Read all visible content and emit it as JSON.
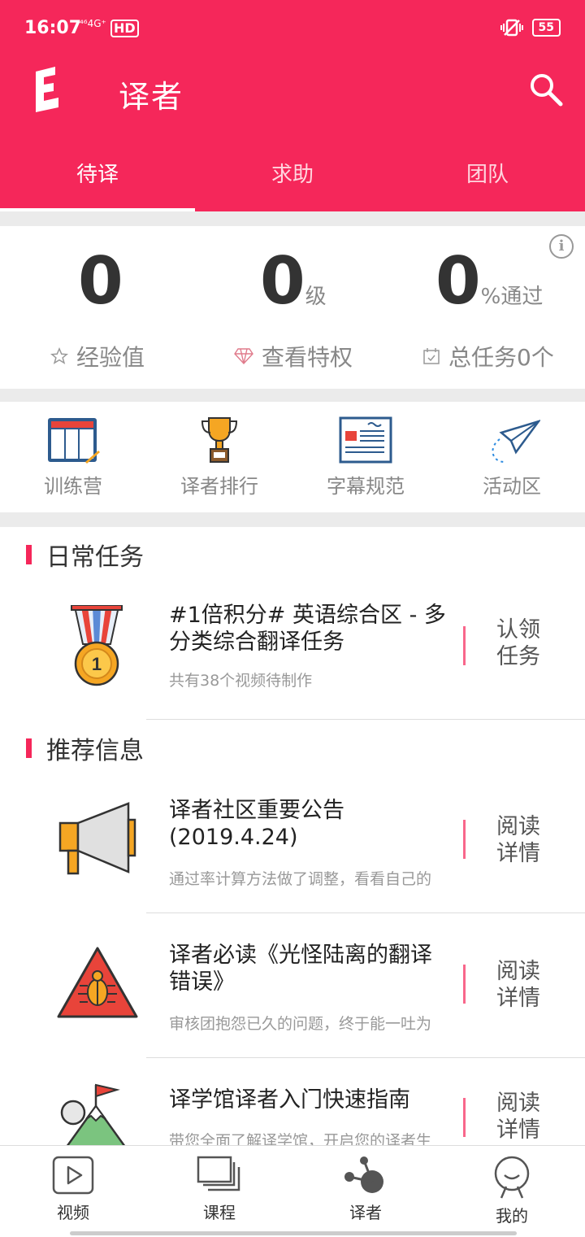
{
  "status_bar": {
    "time": "16:07",
    "signal": "⁴⁶4G⁺",
    "hd": "HD",
    "battery": "55"
  },
  "header": {
    "title": "译者"
  },
  "tabs": [
    {
      "label": "待译",
      "active": true
    },
    {
      "label": "求助",
      "active": false
    },
    {
      "label": "团队",
      "active": false
    }
  ],
  "stats": {
    "experience": {
      "value": "0",
      "label": "经验值"
    },
    "level": {
      "value": "0",
      "unit": "级",
      "label": "查看特权"
    },
    "pass_rate": {
      "value": "0",
      "unit": "%通过",
      "label": "总任务0个"
    }
  },
  "quick_links": [
    {
      "label": "训练营",
      "icon": "training-camp-icon"
    },
    {
      "label": "译者排行",
      "icon": "trophy-icon"
    },
    {
      "label": "字幕规范",
      "icon": "document-icon"
    },
    {
      "label": "活动区",
      "icon": "paper-plane-icon"
    }
  ],
  "daily_tasks": {
    "title": "日常任务",
    "items": [
      {
        "title": "#1倍积分# 英语综合区 - 多分类综合翻译任务",
        "desc": "共有38个视频待制作",
        "action": "认领任务",
        "icon": "medal-icon"
      }
    ]
  },
  "recommendations": {
    "title": "推荐信息",
    "items": [
      {
        "title": "译者社区重要公告(2019.4.24)",
        "desc": "通过率计算方法做了调整，看看自己的",
        "action": "阅读详情",
        "icon": "megaphone-icon"
      },
      {
        "title": "译者必读《光怪陆离的翻译错误》",
        "desc": "审核团抱怨已久的问题，终于能一吐为",
        "action": "阅读详情",
        "icon": "bug-warning-icon"
      },
      {
        "title": "译学馆译者入门快速指南",
        "desc": "带您全面了解译学馆，开启您的译者生",
        "action": "阅读详情",
        "icon": "mountain-flag-icon"
      }
    ]
  },
  "bottom_nav": [
    {
      "label": "视频",
      "icon": "play-icon"
    },
    {
      "label": "课程",
      "icon": "course-icon"
    },
    {
      "label": "译者",
      "icon": "translator-icon"
    },
    {
      "label": "我的",
      "icon": "profile-icon"
    }
  ],
  "colors": {
    "brand": "#f5275a",
    "tab_inactive": "#ffd6df"
  }
}
